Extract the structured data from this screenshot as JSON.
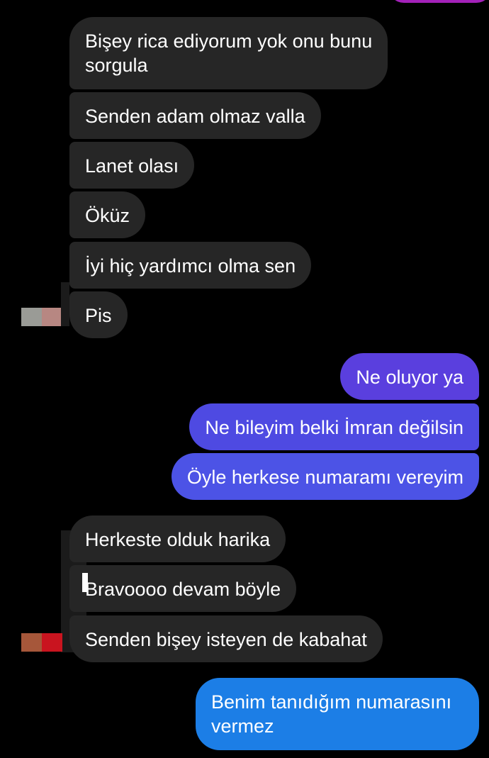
{
  "colors": {
    "background": "#000000",
    "incoming_bubble": "#262626",
    "outgoing_purple": "#5a3fde",
    "outgoing_indigo": "#4d4fe4",
    "outgoing_blue": "#1c7ee6",
    "top_accent": "#a321b9"
  },
  "messages": [
    {
      "direction": "incoming",
      "text": "Bişey rica ediyorum yok onu bunu\nsorgula"
    },
    {
      "direction": "incoming",
      "text": "Senden adam olmaz valla"
    },
    {
      "direction": "incoming",
      "text": "Lanet olası"
    },
    {
      "direction": "incoming",
      "text": "Öküz"
    },
    {
      "direction": "incoming",
      "text": "İyi hiç yardımcı olma sen"
    },
    {
      "direction": "incoming",
      "text": "Pis"
    },
    {
      "direction": "outgoing",
      "text": "Ne oluyor ya"
    },
    {
      "direction": "outgoing",
      "text": "Ne bileyim belki İmran değilsin"
    },
    {
      "direction": "outgoing",
      "text": "Öyle herkese numaramı vereyim"
    },
    {
      "direction": "incoming",
      "text": "Herkeste olduk harika"
    },
    {
      "direction": "incoming",
      "text": "Bravoooo devam böyle"
    },
    {
      "direction": "incoming",
      "text": "Senden bişey isteyen de kabahat"
    },
    {
      "direction": "outgoing",
      "text": "Benim tanıdığım numarasını\nvermez"
    }
  ]
}
